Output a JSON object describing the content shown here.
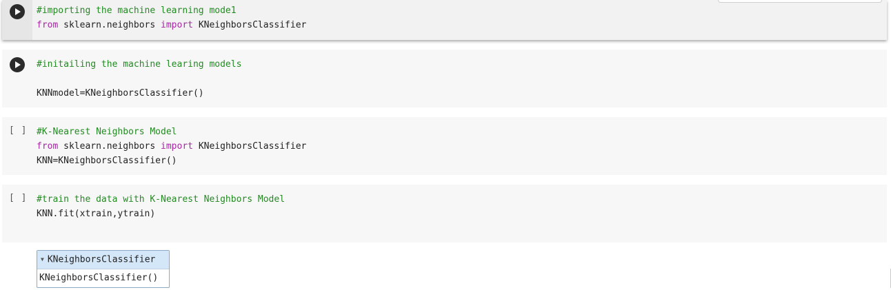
{
  "cells": [
    {
      "id": "cell-1",
      "state": "run",
      "lines": [
        [
          {
            "t": "cmt",
            "text": "#importing the machine learning mode1"
          }
        ],
        [
          {
            "t": "kw",
            "text": "from"
          },
          {
            "t": "plain",
            "text": " sklearn.neighbors "
          },
          {
            "t": "kw",
            "text": "import"
          },
          {
            "t": "plain",
            "text": " KNeighborsClassifier"
          }
        ]
      ]
    },
    {
      "id": "cell-2",
      "state": "run",
      "lines": [
        [
          {
            "t": "cmt",
            "text": "#initailing the machine learing models"
          }
        ],
        [],
        [
          {
            "t": "plain",
            "text": "KNNmodel=KNeighborsClassifier()"
          }
        ]
      ]
    },
    {
      "id": "cell-3",
      "state": "idle",
      "bracket": "[ ]",
      "lines": [
        [
          {
            "t": "cmt",
            "text": "#K-Nearest Neighbors Model"
          }
        ],
        [
          {
            "t": "kw",
            "text": "from"
          },
          {
            "t": "plain",
            "text": " sklearn.neighbors "
          },
          {
            "t": "kw",
            "text": "import"
          },
          {
            "t": "plain",
            "text": " KNeighborsClassifier"
          }
        ],
        [
          {
            "t": "plain",
            "text": "KNN=KNeighborsClassifier()"
          }
        ]
      ]
    },
    {
      "id": "cell-4",
      "state": "idle",
      "bracket": "[ ]",
      "lines": [
        [
          {
            "t": "cmt",
            "text": "#train the data with K-Nearest Neighbors Model"
          }
        ],
        [
          {
            "t": "plain",
            "text": "KNN.fit(xtrain,ytrain)"
          }
        ]
      ]
    }
  ],
  "output": {
    "caret": "▼",
    "header": "KNeighborsClassifier",
    "body": "KNeighborsClassifier()"
  },
  "colors": {
    "comment": "#238a22",
    "keyword": "#a626a4",
    "output_header": "#d4e7f9"
  }
}
